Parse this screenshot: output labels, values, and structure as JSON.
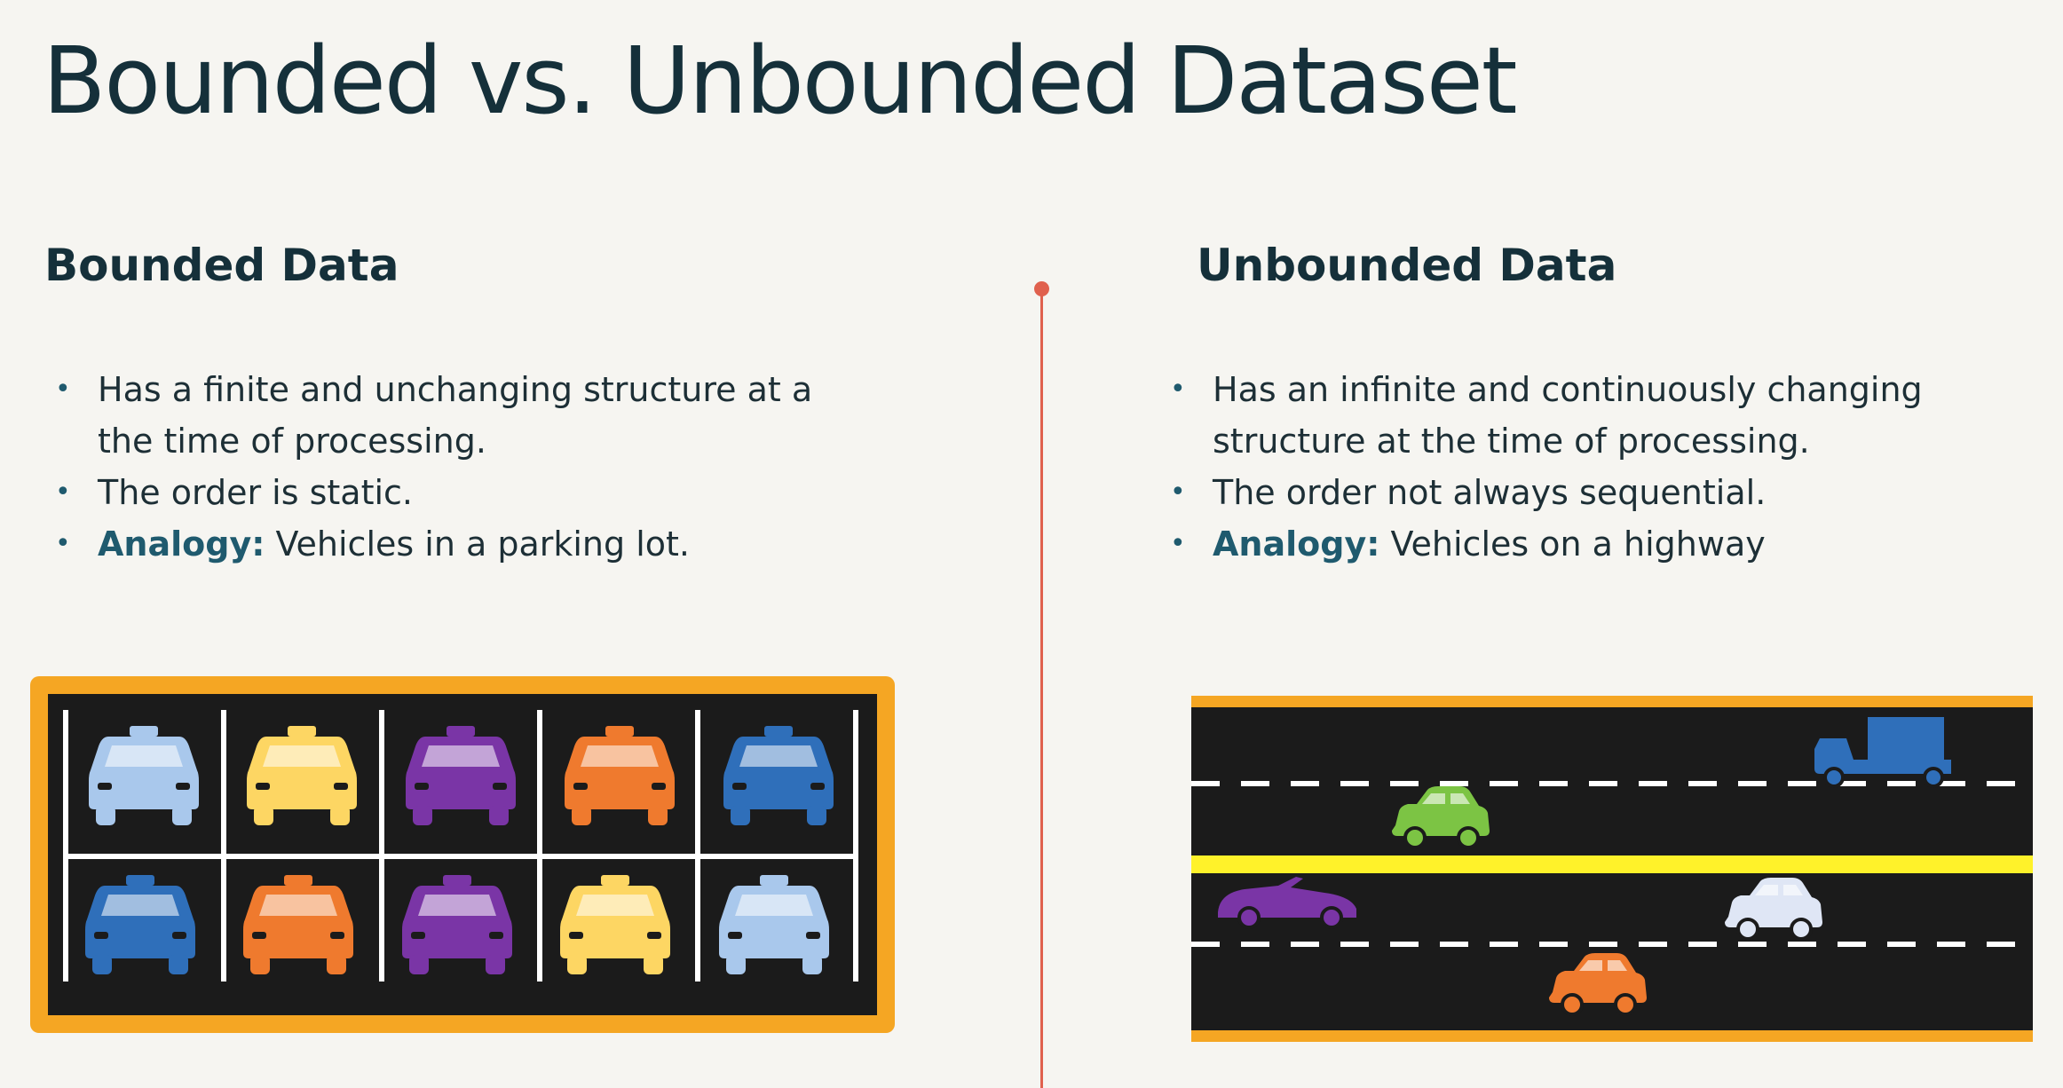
{
  "slide": {
    "title": "Bounded vs. Unbounded Dataset"
  },
  "bounded": {
    "heading": "Bounded Data",
    "bullets": [
      "Has a finite and unchanging structure at a the time of processing.",
      "The order is static."
    ],
    "analogy_label": "Analogy:",
    "analogy_text": " Vehicles in a parking lot."
  },
  "unbounded": {
    "heading": "Unbounded Data",
    "bullets": [
      "Has an infinite and continuously changing structure at the time of processing.",
      "The order not always sequential."
    ],
    "analogy_label": "Analogy:",
    "analogy_text": " Vehicles on a highway"
  },
  "illustrations": {
    "parking_lot": {
      "icon": "parking-lot-icon",
      "top_row": [
        "light-blue-taxi-icon",
        "yellow-taxi-icon",
        "purple-taxi-icon",
        "orange-taxi-icon",
        "blue-taxi-icon"
      ],
      "bottom_row": [
        "blue-taxi-icon",
        "orange-taxi-icon",
        "purple-taxi-icon",
        "yellow-taxi-icon",
        "light-blue-taxi-icon"
      ]
    },
    "highway": {
      "icon": "highway-icon",
      "vehicles": [
        "blue-truck-icon",
        "green-car-icon",
        "purple-convertible-icon",
        "light-blue-car-icon",
        "orange-car-icon"
      ]
    }
  },
  "colors": {
    "background": "#f6f5f1",
    "title_text": "#15303a",
    "accent_teal": "#1f5a6e",
    "divider": "#e0614e",
    "frame_orange": "#f5a623",
    "asphalt": "#1b1b1b",
    "center_line_yellow": "#fff22a",
    "taxi_light_blue": "#a9c8ec",
    "taxi_yellow": "#fdd663",
    "taxi_purple": "#7a35a6",
    "taxi_orange": "#ef7a2e",
    "taxi_blue": "#2f6fba",
    "car_green": "#7cc444"
  }
}
